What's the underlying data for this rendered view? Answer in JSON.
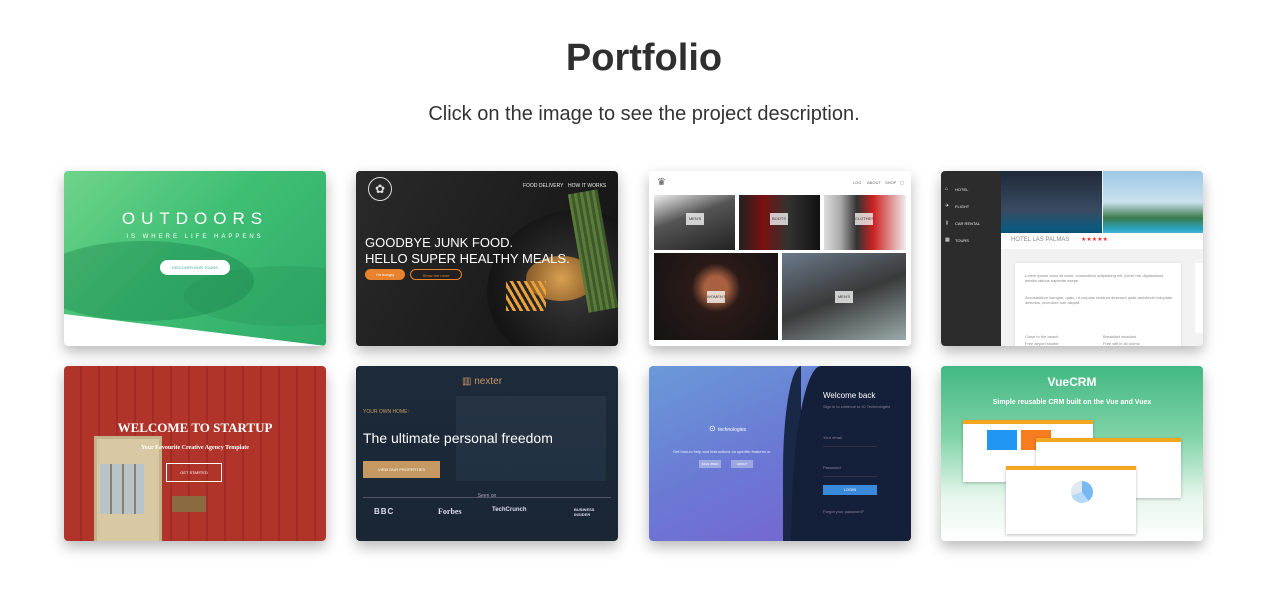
{
  "page": {
    "title": "Portfolio",
    "subtitle": "Click on the image to see the project description."
  },
  "cards": [
    {
      "name": "outdoors",
      "heading": "OUTDOORS",
      "tagline": "IS WHERE LIFE HAPPENS",
      "button": "DISCOVER OUR TOURS"
    },
    {
      "name": "food",
      "nav": [
        "FOOD DELIVERY",
        "HOW IT WORKS"
      ],
      "heading_line1": "GOODBYE JUNK FOOD.",
      "heading_line2": "HELLO SUPER HEALTHY MEALS.",
      "button1": "I'm hungry",
      "button2": "Show me more"
    },
    {
      "name": "photo-gallery",
      "nav": [
        "LOG",
        "ABOUT",
        "SHOP",
        "CART"
      ],
      "labels": [
        "MEN'S",
        "BOOTS",
        "CLOTHES",
        "WOMEN'S",
        "MEN'S"
      ]
    },
    {
      "name": "hotel",
      "menu": [
        "HOTEL",
        "FLIGHT",
        "CAR RENTAL",
        "TOURS"
      ],
      "hotel_name": "HOTEL LAS PALMAS",
      "stars": "★★★★★",
      "text1": "Lorem ipsum dolor sit amet, consectetur adipisicing elit. Animi nisi dignissimos debitis ratione sapiente saepe.",
      "text2": "Accusantium cumque, quas, ut corporis incidunt deserunt quae architecto voluptate delectus, inventore iure aliquid.",
      "list": [
        "Close to the beach",
        "Free airport shuttle",
        "Breakfast included",
        "Free wifi in all rooms"
      ]
    },
    {
      "name": "startup",
      "heading": "WELCOME TO STARTUP",
      "tagline": "Your Favourite Creative Agency Template",
      "button": "GET STARTED"
    },
    {
      "name": "nexter",
      "logo": "nexter",
      "kicker": "YOUR OWN HOME:",
      "heading": "The ultimate personal freedom",
      "button": "VIEW OUR PROPERTIES",
      "seen_on": "Seen on",
      "brands": [
        "BBC",
        "Forbes",
        "TechCrunch",
        "BUSINESS INSIDER"
      ]
    },
    {
      "name": "login",
      "logo": "technologies",
      "tagline": "Get how-to help and instructions on specific features or",
      "small_buttons": [
        "SIGN OPEN",
        "ABOUT"
      ],
      "welcome": "Welcome back",
      "subtext": "Sign in to continue to IO Technologies",
      "email_label": "Your email",
      "password_label": "Password",
      "login_button": "LOGIN",
      "forgot": "Forgot your password?"
    },
    {
      "name": "vuecrm",
      "heading": "VueCRM",
      "tagline": "Simple reusable CRM built on the Vue and Vuex"
    }
  ],
  "colors": {
    "outdoors": "#3fbf74",
    "food_accent": "#e8822c",
    "nexter_gold": "#c69963",
    "vue_green": "#42b883",
    "login_dark": "#141f3a"
  }
}
